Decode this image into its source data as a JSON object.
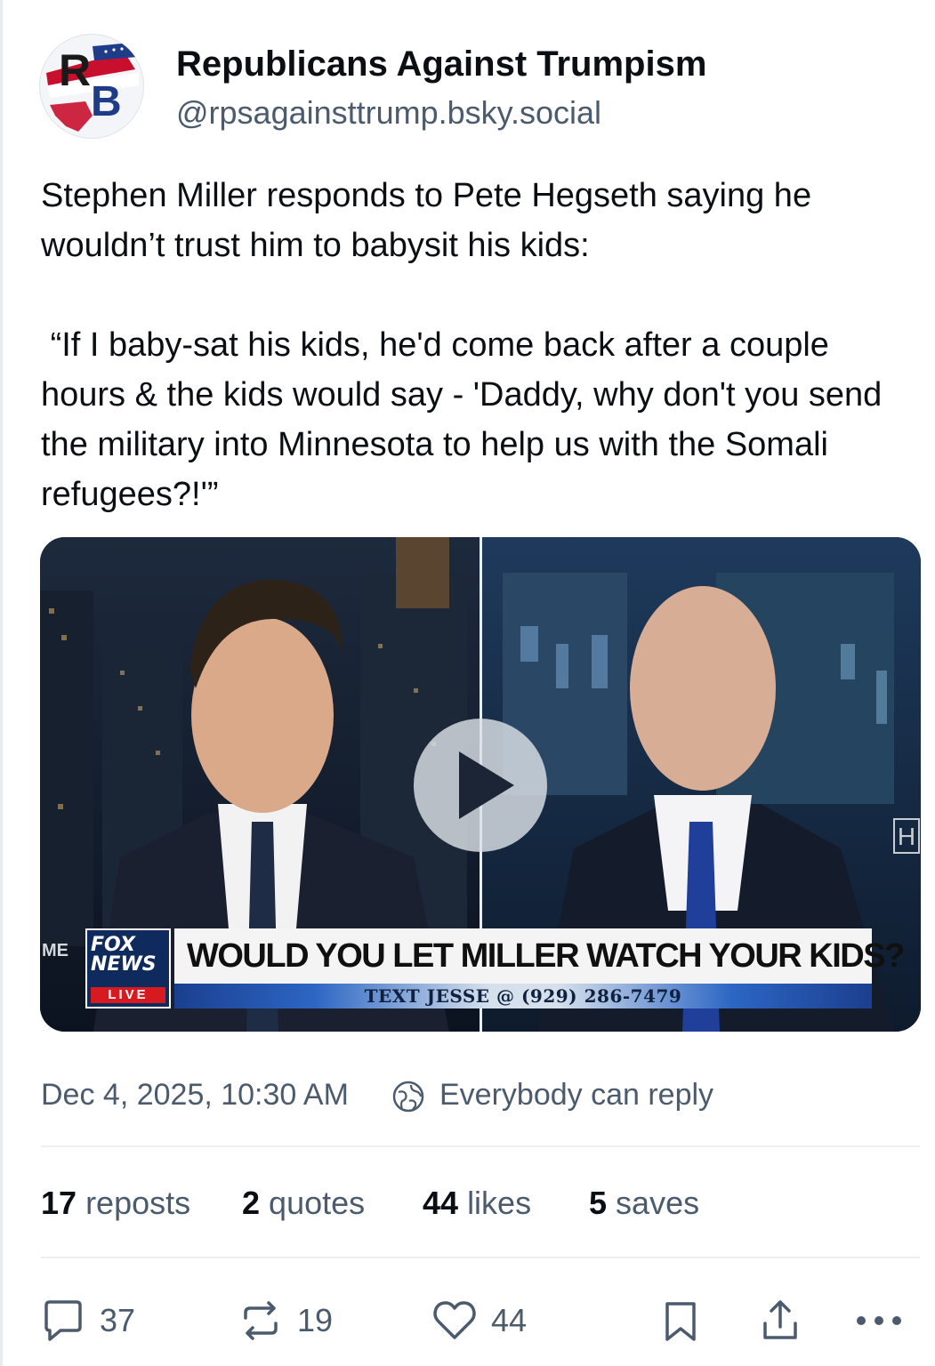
{
  "author": {
    "name": "Republicans Against Trumpism",
    "handle": "@rpsagainsttrump.bsky.social",
    "avatar_icon": "rb-logo-icon"
  },
  "post": {
    "paragraphs": [
      "Stephen Miller responds to Pete Hegseth saying he wouldn’t trust him to babysit his kids:",
      " “If I baby-sat his kids, he'd come back after a couple hours & the kids would say - 'Daddy, why don't you send the military into Minnesota to help us with the Somali refugees?!'”"
    ]
  },
  "media": {
    "type": "video",
    "play_icon": "play-icon",
    "chyron": {
      "logo_line1": "FOX",
      "logo_line2": "NEWS",
      "logo_live": "LIVE",
      "headline": "WOULD YOU LET MILLER WATCH YOUR KIDS?",
      "subline": "TEXT JESSE @ (929) 286-7479"
    },
    "edge_left_text": "ME",
    "edge_right_text": "H"
  },
  "meta": {
    "date": "Dec 4, 2025, 10:30 AM",
    "reply_setting": "Everybody can reply",
    "reply_setting_icon": "globe-icon"
  },
  "stats": {
    "reposts": {
      "count": "17",
      "label": "reposts"
    },
    "quotes": {
      "count": "2",
      "label": "quotes"
    },
    "likes": {
      "count": "44",
      "label": "likes"
    },
    "saves": {
      "count": "5",
      "label": "saves"
    }
  },
  "actions": {
    "reply": {
      "icon": "comment-icon",
      "count": "37"
    },
    "repost": {
      "icon": "repost-icon",
      "count": "19"
    },
    "like": {
      "icon": "heart-icon",
      "count": "44"
    },
    "bookmark": {
      "icon": "bookmark-icon"
    },
    "share": {
      "icon": "share-icon"
    },
    "more": {
      "icon": "more-icon"
    }
  },
  "colors": {
    "text_primary": "#0b0f14",
    "text_secondary": "#4b5b6d",
    "divider": "#eceff2",
    "fox_red": "#d71920",
    "fox_blue": "#0f2a5c"
  }
}
